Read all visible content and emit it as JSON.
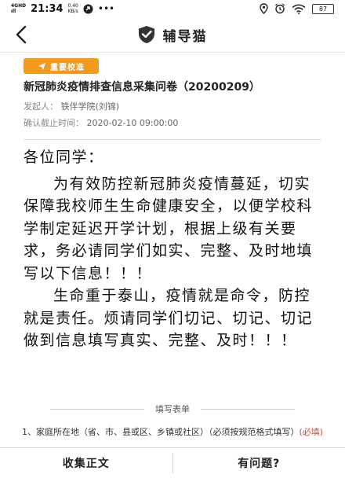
{
  "status_bar": {
    "network": "4GHD",
    "network_sub": "ıll",
    "time": "21:34",
    "speed_value": "0.40",
    "speed_unit": "KB/s",
    "battery": "87",
    "icons": [
      "location-icon",
      "alarm-icon",
      "wifi-icon",
      "battery-icon"
    ]
  },
  "header": {
    "title": "辅导猫",
    "back_icon": "chevron-left-icon",
    "logo_icon": "shield-check-icon"
  },
  "survey": {
    "tag": "重要校准",
    "title": "新冠肺炎疫情排查信息采集问卷（20200209）",
    "initiator_label": "发起人：",
    "initiator_value": "铁伴学院(刘锦)",
    "deadline_label": "确认截止时间：",
    "deadline_value": "2020-02-10 09:00:00",
    "accent_color": "#f39a1c"
  },
  "notice": {
    "greeting": "各位同学：",
    "paragraph1": "为有效防控新冠肺炎疫情蔓延，切实保障我校师生生命健康安全，以便学校科学制定延迟开学计划，根据上级有关要求，务必请同学们如实、完整、及时地填写以下信息！！！",
    "paragraph2": "生命重于泰山，疫情就是命令，防控就是责任。烦请同学们切记、切记、切记做到信息填写真实、完整、及时！！！"
  },
  "form": {
    "section_label": "填写表单",
    "question1": "1、家庭所在地（省、市、县或区、乡镇或社区）（必须按规范格式填写）",
    "question1_required": "(必填)"
  },
  "bottom_bar": {
    "left_button": "收集正文",
    "right_button": "有问题?"
  }
}
